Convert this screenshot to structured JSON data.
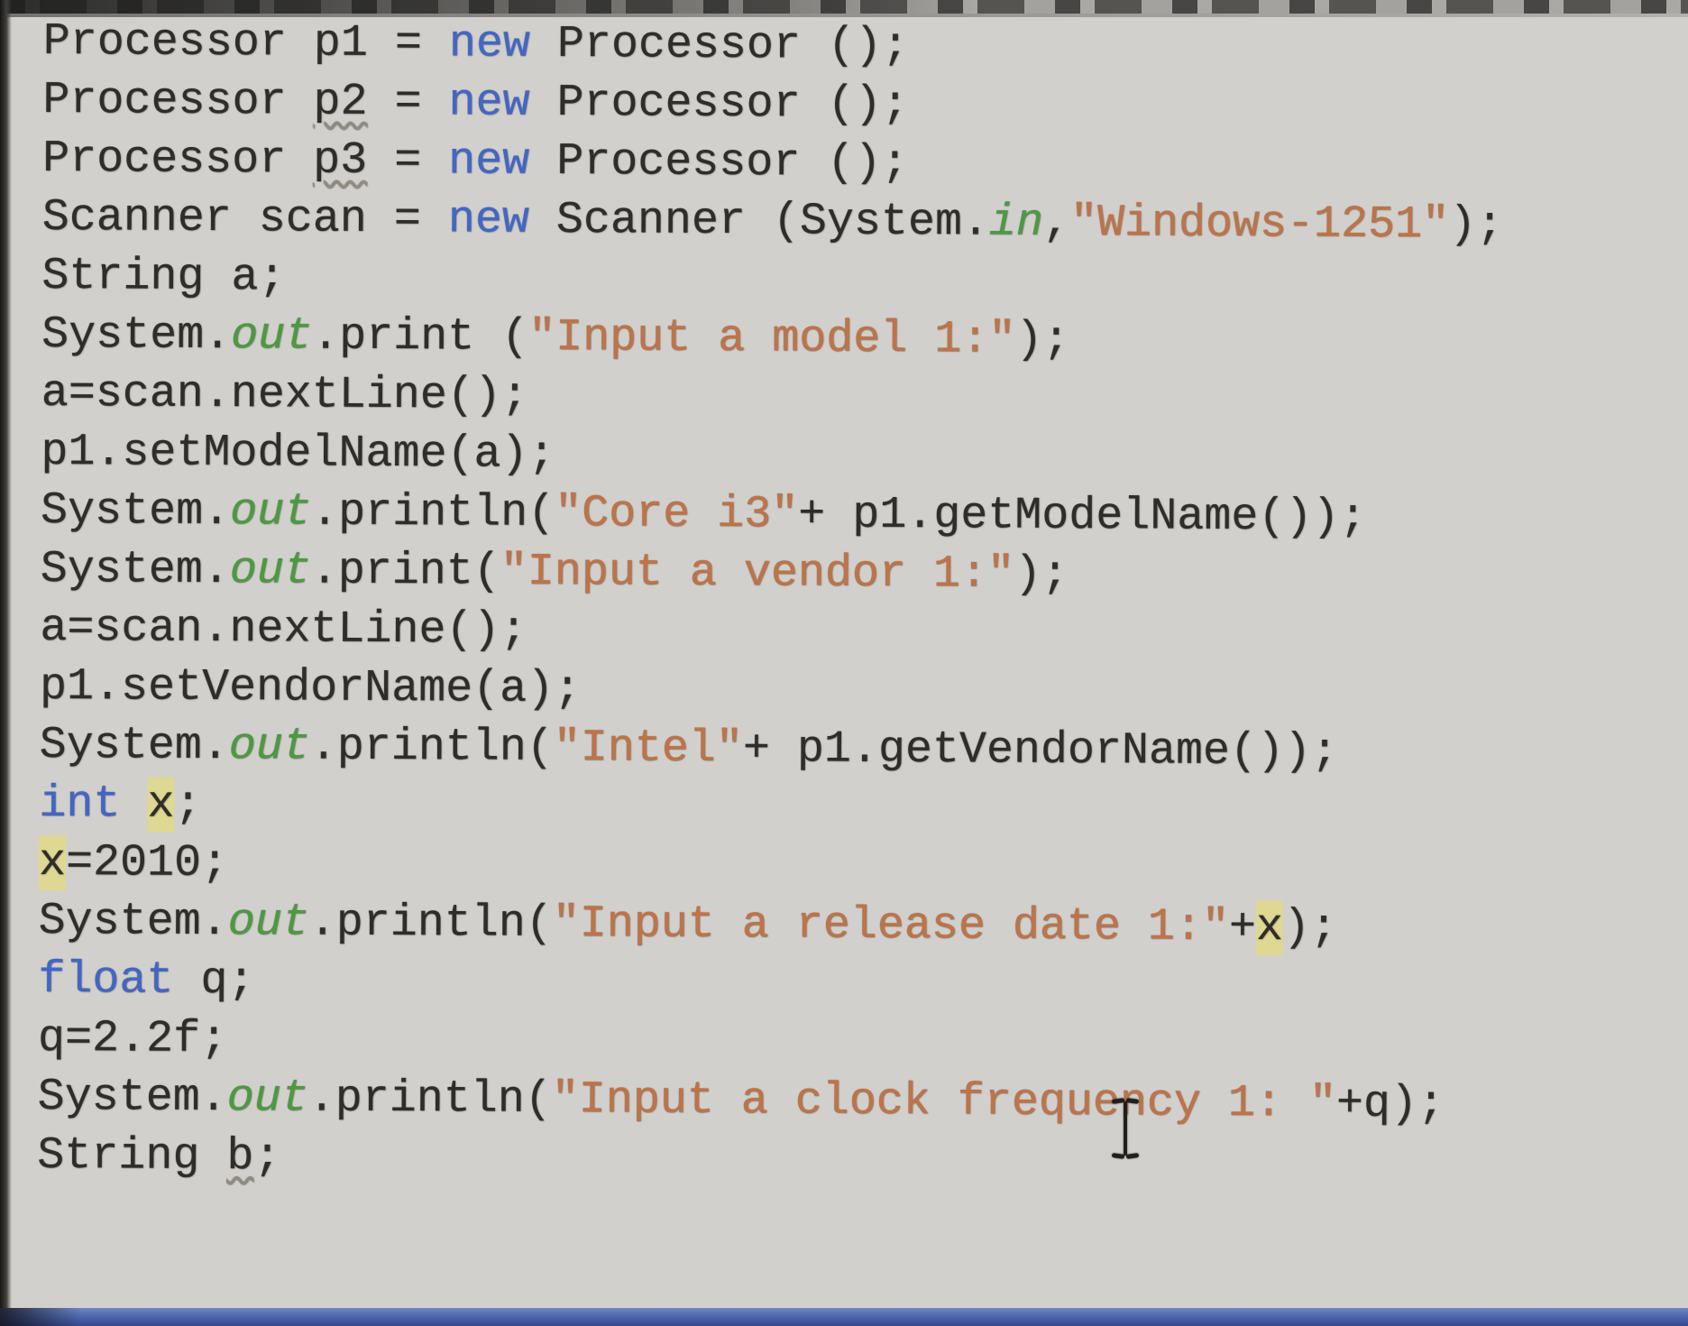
{
  "app": {
    "description": "Photograph of a screen showing a Java source file open in an IDE code editor",
    "visible_chrome": {
      "top_strip": "cut-off bottom edge of toolbar / previous editor row",
      "bottom_strip": "cut-off blue bar (window taskbar edge)",
      "left_edge": "dark monitor bezel / photo edge"
    }
  },
  "editor": {
    "language": "Java",
    "syntax_colors": {
      "text": "#2f2d29",
      "keyword": "#4066c8",
      "static_field": "#4a9b40",
      "string": "#bf7347",
      "occurrence_highlight": "#ded893",
      "wavy_underline": "#8f8b83",
      "background": "#d2d0cc"
    },
    "lines": [
      {
        "tokens": [
          {
            "t": "Processor p1 = ",
            "s": "p"
          },
          {
            "t": "new",
            "s": "k"
          },
          {
            "t": " Processor ();",
            "s": "p"
          }
        ]
      },
      {
        "tokens": [
          {
            "t": "Processor ",
            "s": "p"
          },
          {
            "t": "p2",
            "s": "p",
            "wavy": true
          },
          {
            "t": " = ",
            "s": "p"
          },
          {
            "t": "new",
            "s": "k"
          },
          {
            "t": " Processor ();",
            "s": "p"
          }
        ]
      },
      {
        "tokens": [
          {
            "t": "Processor ",
            "s": "p"
          },
          {
            "t": "p3",
            "s": "p",
            "wavy": true
          },
          {
            "t": " = ",
            "s": "p"
          },
          {
            "t": "new",
            "s": "k"
          },
          {
            "t": " Processor ();",
            "s": "p"
          }
        ]
      },
      {
        "tokens": [
          {
            "t": "Scanner scan = ",
            "s": "p"
          },
          {
            "t": "new",
            "s": "k"
          },
          {
            "t": " Scanner (System.",
            "s": "p"
          },
          {
            "t": "in",
            "s": "f"
          },
          {
            "t": ",",
            "s": "p"
          },
          {
            "t": "\"Windows-1251\"",
            "s": "s"
          },
          {
            "t": ");",
            "s": "p"
          }
        ]
      },
      {
        "tokens": [
          {
            "t": "String a;",
            "s": "p"
          }
        ]
      },
      {
        "tokens": [
          {
            "t": "System.",
            "s": "p"
          },
          {
            "t": "out",
            "s": "f"
          },
          {
            "t": ".print (",
            "s": "p"
          },
          {
            "t": "\"Input a model 1:\"",
            "s": "s"
          },
          {
            "t": ");",
            "s": "p"
          }
        ]
      },
      {
        "tokens": [
          {
            "t": "a=scan.nextLine();",
            "s": "p"
          }
        ]
      },
      {
        "tokens": [
          {
            "t": "p1.setModelName(a);",
            "s": "p"
          }
        ]
      },
      {
        "tokens": [
          {
            "t": "System.",
            "s": "p"
          },
          {
            "t": "out",
            "s": "f"
          },
          {
            "t": ".println(",
            "s": "p"
          },
          {
            "t": "\"Core i3\"",
            "s": "s"
          },
          {
            "t": "+ p1.getModelName());",
            "s": "p"
          }
        ]
      },
      {
        "tokens": [
          {
            "t": "System.",
            "s": "p"
          },
          {
            "t": "out",
            "s": "f"
          },
          {
            "t": ".print(",
            "s": "p"
          },
          {
            "t": "\"Input a vendor 1:\"",
            "s": "s"
          },
          {
            "t": ");",
            "s": "p"
          }
        ]
      },
      {
        "tokens": [
          {
            "t": "a=scan.nextLine();",
            "s": "p"
          }
        ]
      },
      {
        "tokens": [
          {
            "t": "p1.setVendorName(a);",
            "s": "p"
          }
        ]
      },
      {
        "tokens": [
          {
            "t": "System.",
            "s": "p"
          },
          {
            "t": "out",
            "s": "f"
          },
          {
            "t": ".println(",
            "s": "p"
          },
          {
            "t": "\"Intel\"",
            "s": "s"
          },
          {
            "t": "+ p1.getVendorName());",
            "s": "p"
          }
        ]
      },
      {
        "tokens": [
          {
            "t": "int",
            "s": "k"
          },
          {
            "t": " ",
            "s": "p"
          },
          {
            "t": "x",
            "s": "h"
          },
          {
            "t": ";",
            "s": "p"
          }
        ]
      },
      {
        "tokens": [
          {
            "t": "x",
            "s": "h"
          },
          {
            "t": "=2010;",
            "s": "p"
          }
        ]
      },
      {
        "tokens": [
          {
            "t": "System.",
            "s": "p"
          },
          {
            "t": "out",
            "s": "f"
          },
          {
            "t": ".println(",
            "s": "p"
          },
          {
            "t": "\"Input a release date 1:\"",
            "s": "s"
          },
          {
            "t": "+",
            "s": "p"
          },
          {
            "t": "x",
            "s": "h"
          },
          {
            "t": ");",
            "s": "p"
          }
        ]
      },
      {
        "tokens": [
          {
            "t": "float",
            "s": "k"
          },
          {
            "t": " q;",
            "s": "p"
          }
        ]
      },
      {
        "tokens": [
          {
            "t": "q=2.2f;",
            "s": "p"
          }
        ]
      },
      {
        "tokens": [
          {
            "t": "System.",
            "s": "p"
          },
          {
            "t": "out",
            "s": "f"
          },
          {
            "t": ".println(",
            "s": "p"
          },
          {
            "t": "\"Input a clock frequency 1: \"",
            "s": "s"
          },
          {
            "t": "+q);",
            "s": "p"
          }
        ]
      },
      {
        "tokens": [
          {
            "t": "String ",
            "s": "p"
          },
          {
            "t": "b",
            "s": "p",
            "wavy": true
          },
          {
            "t": ";",
            "s": "p"
          }
        ]
      }
    ]
  },
  "pointer": {
    "shape": "text-ibeam-cursor",
    "over_word": "frequency",
    "over_line_number": 19
  }
}
